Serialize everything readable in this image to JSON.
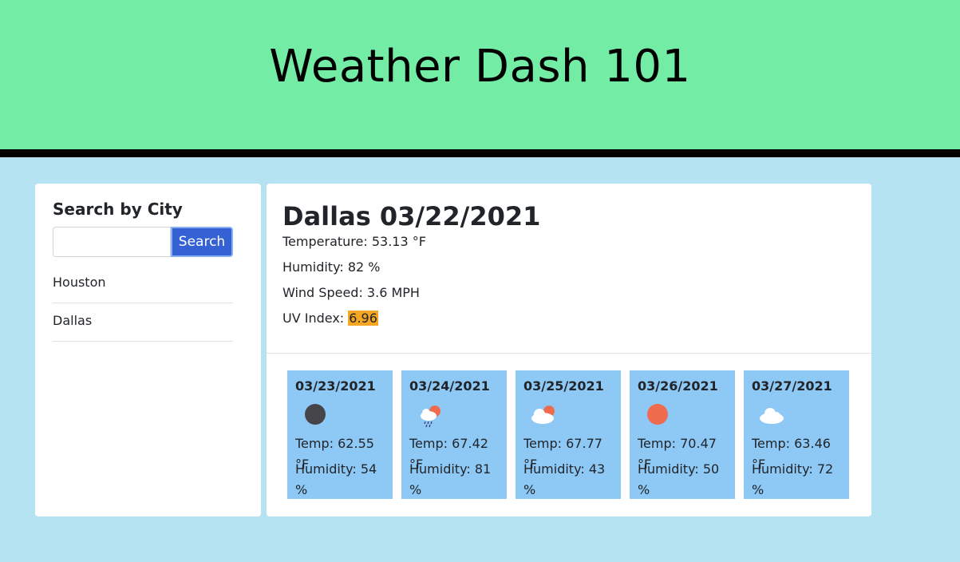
{
  "header": {
    "title": "Weather Dash 101"
  },
  "sidebar": {
    "heading": "Search by City",
    "search_value": "",
    "search_placeholder": "",
    "search_button": "Search",
    "cities": [
      "Houston",
      "Dallas"
    ]
  },
  "current": {
    "title": "Dallas 03/22/2021",
    "temperature": "Temperature: 53.13 °F",
    "humidity": "Humidity: 82 %",
    "wind": "Wind Speed: 3.6 MPH",
    "uv_label": "UV Index: ",
    "uv_value": "6.96",
    "uv_color": "#f5a623"
  },
  "forecast": [
    {
      "date": "03/23/2021",
      "icon": "night-moon-icon",
      "temp": "Temp: 62.55 °F",
      "humidity": "Humidity: 54 %"
    },
    {
      "date": "03/24/2021",
      "icon": "rain-sun-cloud-icon",
      "temp": "Temp: 67.42 °F",
      "humidity": "Humidity: 81 %"
    },
    {
      "date": "03/25/2021",
      "icon": "partly-cloudy-icon",
      "temp": "Temp: 67.77 °F",
      "humidity": "Humidity: 43 %"
    },
    {
      "date": "03/26/2021",
      "icon": "sun-icon",
      "temp": "Temp: 70.47 °F",
      "humidity": "Humidity: 50 %"
    },
    {
      "date": "03/27/2021",
      "icon": "cloud-icon",
      "temp": "Temp: 63.46 °F",
      "humidity": "Humidity: 72 %"
    }
  ],
  "colors": {
    "header_bg": "#73eda6",
    "page_bg": "#b5e3f2",
    "card_bg": "#8ec8f5",
    "button_bg": "#3461d4"
  }
}
